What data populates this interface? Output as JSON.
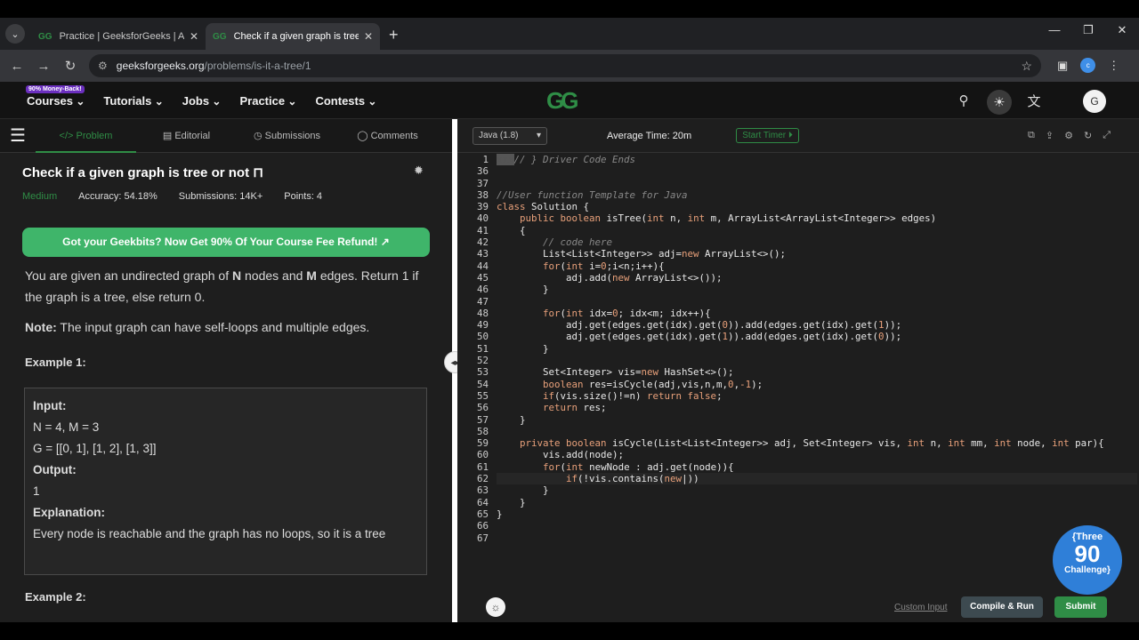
{
  "browser": {
    "tabs": [
      {
        "title": "Practice | GeeksforGeeks | A co",
        "active": false
      },
      {
        "title": "Check if a given graph is tree or",
        "active": true
      }
    ],
    "url_host": "geeksforgeeks.org",
    "url_path": "/problems/is-it-a-tree/1"
  },
  "site": {
    "badge": "90% Money-Back!",
    "menu": [
      "Courses",
      "Tutorials",
      "Jobs",
      "Practice",
      "Contests"
    ],
    "logo": "GG",
    "avatar": "G"
  },
  "left": {
    "tabs": [
      "Problem",
      "Editorial",
      "Submissions",
      "Comments"
    ],
    "title": "Check if a given graph is tree or not",
    "difficulty": "Medium",
    "accuracy": "Accuracy: 54.18%",
    "submissions": "Submissions: 14K+",
    "points": "Points: 4",
    "promo": "Got your Geekbits? Now Get 90% Of Your Course Fee Refund! ↗",
    "desc_a": "You are given an undirected graph of ",
    "desc_n": "N",
    "desc_b": " nodes and ",
    "desc_m": "M",
    "desc_c": " edges. Return 1 if the graph is a tree, else return 0.",
    "note_label": "Note:",
    "note_text": " The input graph can have self-loops and multiple edges.",
    "example1": "Example 1:",
    "input_label": "Input:",
    "input_1": "N = 4, M = 3",
    "input_2": "G = [[0, 1], [1, 2], [1, 3]]",
    "output_label": "Output:",
    "output": "1",
    "expl_label": "Explanation:",
    "expl": "Every node is reachable and the graph has no loops, so it is a tree",
    "example2": "Example 2:"
  },
  "editor": {
    "language": "Java (1.8)",
    "avg_time": "Average Time: 20m",
    "timer": "Start Timer ⏵",
    "line_numbers": [
      "1",
      "36",
      "37",
      "38",
      "39",
      "40",
      "41",
      "42",
      "43",
      "44",
      "45",
      "46",
      "47",
      "48",
      "49",
      "50",
      "51",
      "52",
      "53",
      "54",
      "55",
      "56",
      "57",
      "58",
      "59",
      "60",
      "61",
      "62",
      "63",
      "64",
      "65",
      "66",
      "67"
    ],
    "custom_input": "Custom Input",
    "compile": "Compile & Run",
    "submit": "Submit"
  },
  "overlay": {
    "line1": "{Three",
    "line2": "90",
    "line3": "Challenge}"
  }
}
